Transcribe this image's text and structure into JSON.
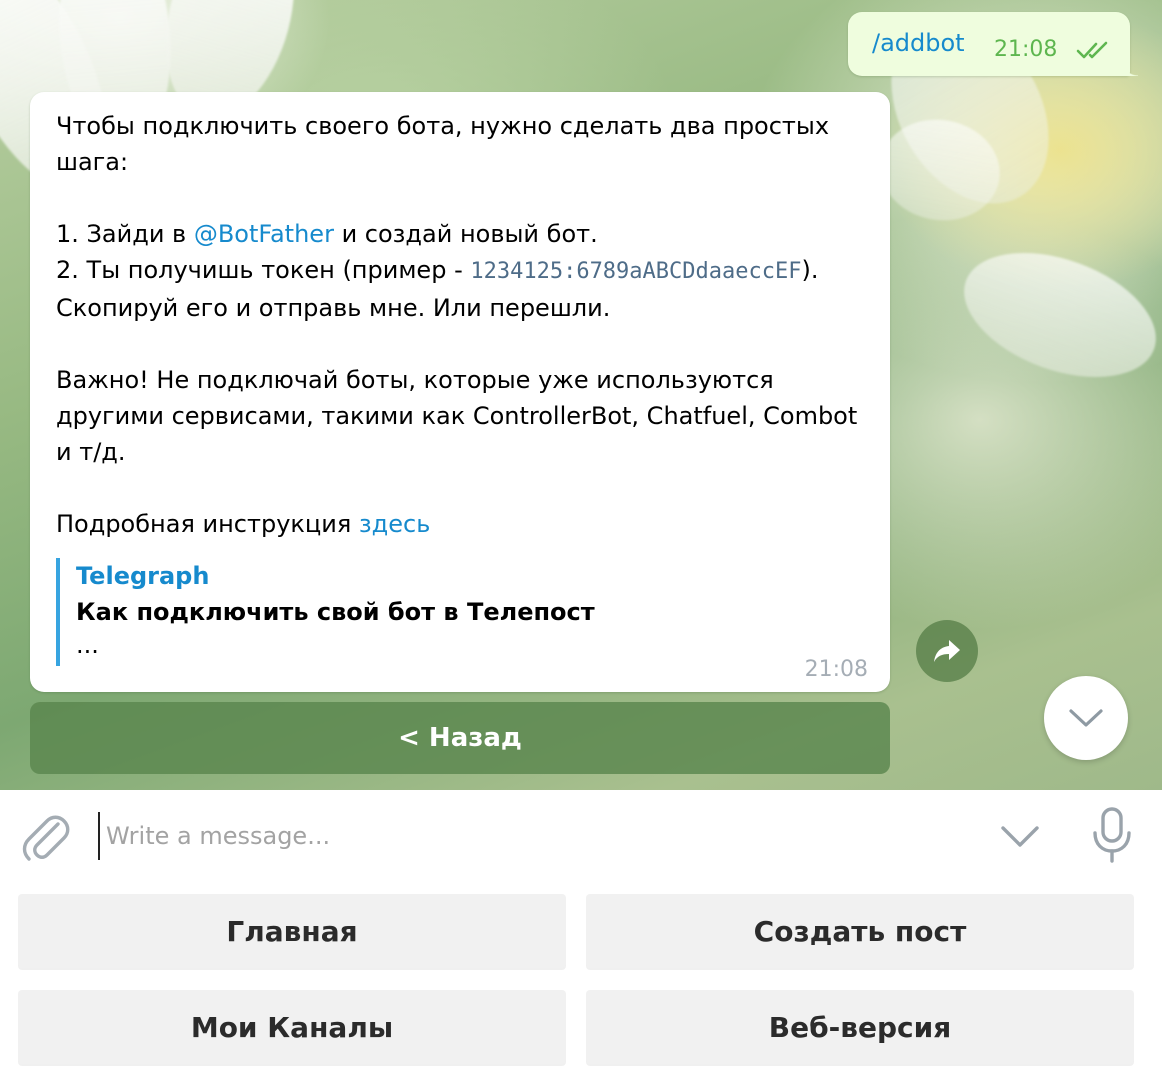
{
  "chat": {
    "outgoing": {
      "text": "/addbot",
      "time": "21:08"
    },
    "incoming": {
      "line1": "Чтобы подключить своего бота, нужно сделать два простых шага:",
      "step1_prefix": "1. Зайди в ",
      "step1_link": "@BotFather",
      "step1_suffix": " и создай новый бот.",
      "step2_prefix": "2. Ты получишь токен (пример - ",
      "step2_code": "1234125:6789aABCDdaaeccEF",
      "step2_suffix": "). Скопируй его и отправь мне. Или перешли.",
      "warning": "Важно! Не подключай боты, которые уже используются другими сервисами, такими как ControllerBot, Chatfuel, Combot и т/д.",
      "instruction_prefix": "Подробная инструкция ",
      "instruction_link": "здесь",
      "preview": {
        "site": "Telegraph",
        "title": "Как подключить свой бот в Телепост",
        "description": "..."
      },
      "time": "21:08"
    },
    "inline_button": "< Назад"
  },
  "composer": {
    "placeholder": "Write a message..."
  },
  "keyboard": {
    "buttons": [
      "Главная",
      "Создать пост",
      "Мои Каналы",
      "Веб-версия"
    ]
  },
  "colors": {
    "link": "#168acd",
    "outgoing_bg": "#effdde",
    "outgoing_time": "#5eb64f",
    "inline_button_bg": "#5a864e"
  }
}
